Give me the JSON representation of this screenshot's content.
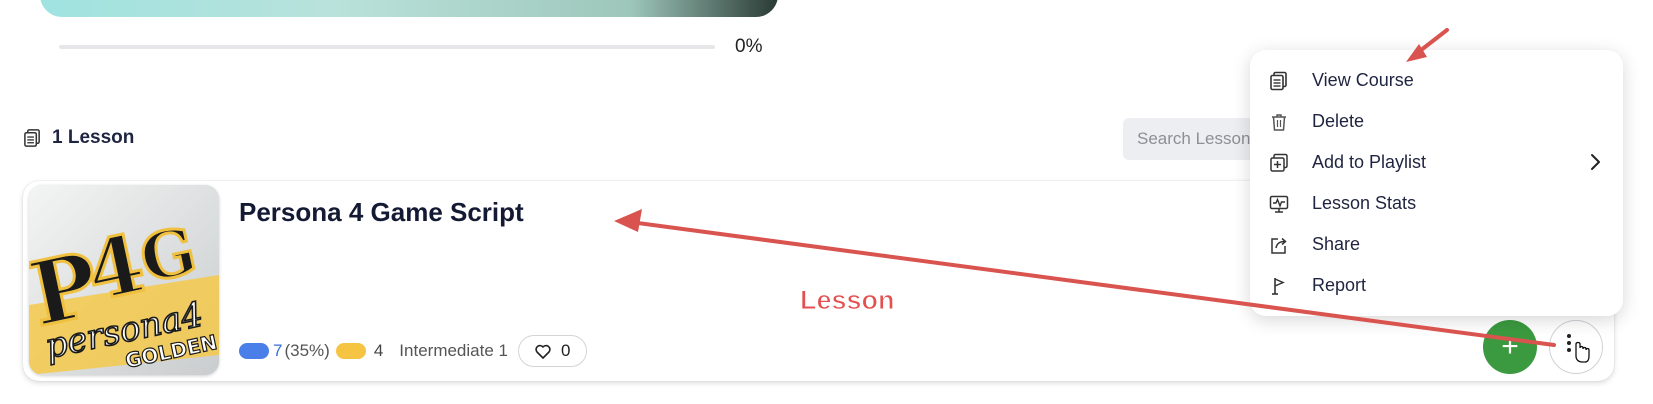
{
  "progress": {
    "value_text": "0%",
    "fraction": 0
  },
  "lessons": {
    "count_label": "1 Lesson"
  },
  "search": {
    "placeholder": "Search Lessons"
  },
  "lesson_card": {
    "title": "Persona 4 Game Script",
    "thumbnail_text": {
      "p": "P",
      "four": "4",
      "g": "G",
      "persona": "persona4",
      "golden": "GOLDEN"
    },
    "known_words": "7",
    "known_percent": "(35%)",
    "lingqs": "4",
    "level": "Intermediate 1",
    "likes": "0"
  },
  "buttons": {
    "add": "+",
    "more": "⋮"
  },
  "context_menu": {
    "items": [
      {
        "label": "View Course",
        "icon": "course-icon"
      },
      {
        "label": "Delete",
        "icon": "trash-icon"
      },
      {
        "label": "Add to Playlist",
        "icon": "playlist-add-icon",
        "has_submenu": true
      },
      {
        "label": "Lesson Stats",
        "icon": "stats-icon"
      },
      {
        "label": "Share",
        "icon": "share-icon"
      },
      {
        "label": "Report",
        "icon": "flag-icon"
      }
    ]
  },
  "annotation": {
    "label": "Lesson",
    "color": "#e45050"
  },
  "colors": {
    "known": "#4a7ee8",
    "lingq": "#f5c443",
    "add_button": "#3b9a3f"
  }
}
